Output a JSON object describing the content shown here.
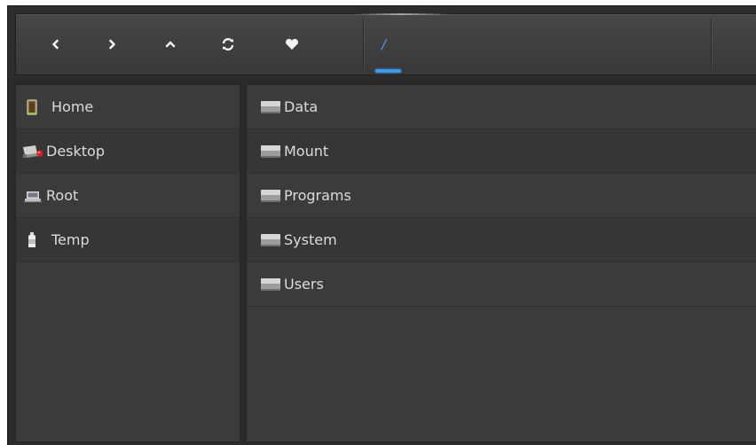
{
  "colors": {
    "accent": "#3d9af0",
    "text": "#dcdcdc",
    "panel": "#3b3b3b",
    "toolbar": "#424242"
  },
  "toolbar": {
    "buttons": [
      {
        "name": "back-button",
        "icon": "chevron-left-icon",
        "glyph": "‹"
      },
      {
        "name": "forward-button",
        "icon": "chevron-right-icon",
        "glyph": "›"
      },
      {
        "name": "up-button",
        "icon": "chevron-up-icon",
        "glyph": "^"
      },
      {
        "name": "refresh-button",
        "icon": "refresh-icon",
        "glyph": "⟳"
      },
      {
        "name": "bookmark-button",
        "icon": "heart-icon",
        "glyph": "♥"
      }
    ],
    "breadcrumb": {
      "current": "/"
    }
  },
  "sidebar": {
    "items": [
      {
        "label": "Home",
        "icon": "home-door-icon"
      },
      {
        "label": "Desktop",
        "icon": "desktop-camera-icon"
      },
      {
        "label": "Root",
        "icon": "root-laptop-icon"
      },
      {
        "label": "Temp",
        "icon": "temp-bottle-icon"
      }
    ]
  },
  "files": {
    "items": [
      {
        "label": "Data",
        "icon": "folder-icon"
      },
      {
        "label": "Mount",
        "icon": "folder-icon"
      },
      {
        "label": "Programs",
        "icon": "folder-icon"
      },
      {
        "label": "System",
        "icon": "folder-icon"
      },
      {
        "label": "Users",
        "icon": "folder-icon"
      }
    ]
  }
}
